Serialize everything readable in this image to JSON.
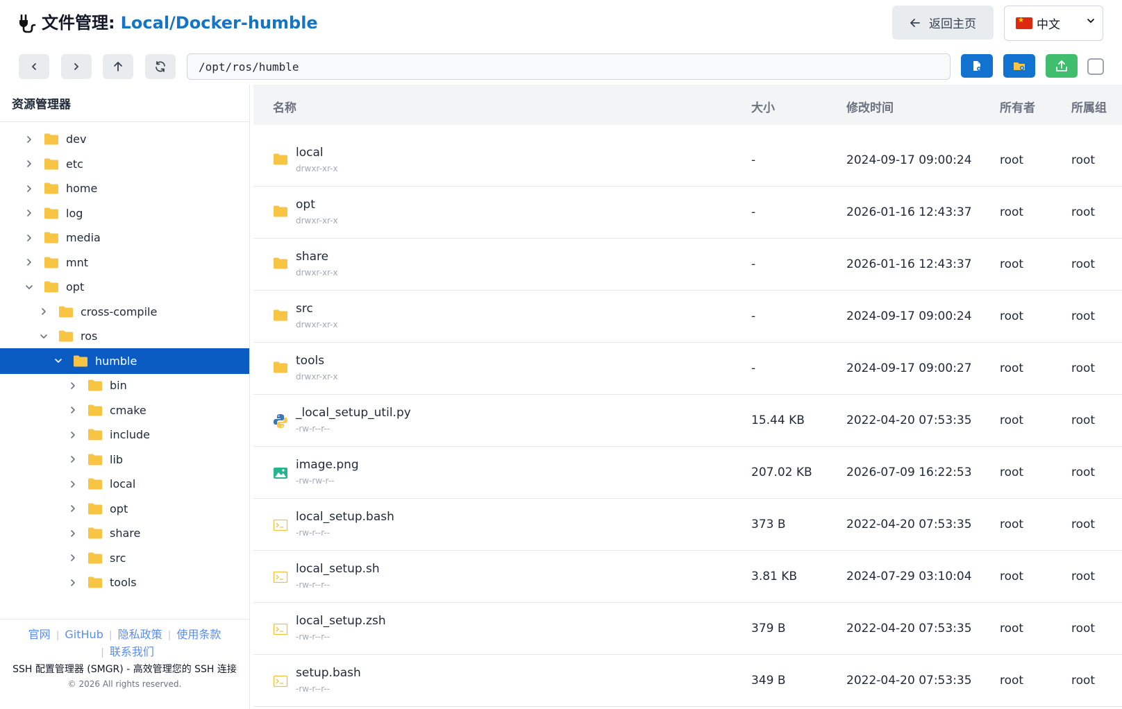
{
  "header": {
    "title_label": "文件管理:",
    "title_path": "Local/Docker-humble",
    "home_button": "返回主页",
    "language": "中文"
  },
  "toolbar": {
    "path": "/opt/ros/humble"
  },
  "sidebar": {
    "title": "资源管理器",
    "items": [
      {
        "label": "dev",
        "depth": 0,
        "expanded": false
      },
      {
        "label": "etc",
        "depth": 0,
        "expanded": false
      },
      {
        "label": "home",
        "depth": 0,
        "expanded": false
      },
      {
        "label": "log",
        "depth": 0,
        "expanded": false
      },
      {
        "label": "media",
        "depth": 0,
        "expanded": false
      },
      {
        "label": "mnt",
        "depth": 0,
        "expanded": false
      },
      {
        "label": "opt",
        "depth": 0,
        "expanded": true
      },
      {
        "label": "cross-compile",
        "depth": 1,
        "expanded": false
      },
      {
        "label": "ros",
        "depth": 1,
        "expanded": true
      },
      {
        "label": "humble",
        "depth": 2,
        "expanded": true,
        "selected": true
      },
      {
        "label": "bin",
        "depth": 3,
        "expanded": false
      },
      {
        "label": "cmake",
        "depth": 3,
        "expanded": false
      },
      {
        "label": "include",
        "depth": 3,
        "expanded": false
      },
      {
        "label": "lib",
        "depth": 3,
        "expanded": false
      },
      {
        "label": "local",
        "depth": 3,
        "expanded": false
      },
      {
        "label": "opt",
        "depth": 3,
        "expanded": false
      },
      {
        "label": "share",
        "depth": 3,
        "expanded": false
      },
      {
        "label": "src",
        "depth": 3,
        "expanded": false
      },
      {
        "label": "tools",
        "depth": 3,
        "expanded": false
      }
    ]
  },
  "footer": {
    "links": [
      "官网",
      "GitHub",
      "隐私政策",
      "使用条款",
      "联系我们"
    ],
    "description": "SSH 配置管理器 (SMGR) - 高效管理您的 SSH 连接",
    "copyright": "© 2026 All rights reserved."
  },
  "table": {
    "headers": {
      "name": "名称",
      "size": "大小",
      "mtime": "修改时间",
      "owner": "所有者",
      "group": "所属组"
    },
    "rows": [
      {
        "name": "local",
        "perm": "drwxr-xr-x",
        "size": "-",
        "mtime": "2024-09-17 09:00:24",
        "owner": "root",
        "group": "root",
        "type": "folder"
      },
      {
        "name": "opt",
        "perm": "drwxr-xr-x",
        "size": "-",
        "mtime": "2026-01-16 12:43:37",
        "owner": "root",
        "group": "root",
        "type": "folder"
      },
      {
        "name": "share",
        "perm": "drwxr-xr-x",
        "size": "-",
        "mtime": "2026-01-16 12:43:37",
        "owner": "root",
        "group": "root",
        "type": "folder"
      },
      {
        "name": "src",
        "perm": "drwxr-xr-x",
        "size": "-",
        "mtime": "2024-09-17 09:00:24",
        "owner": "root",
        "group": "root",
        "type": "folder"
      },
      {
        "name": "tools",
        "perm": "drwxr-xr-x",
        "size": "-",
        "mtime": "2024-09-17 09:00:27",
        "owner": "root",
        "group": "root",
        "type": "folder"
      },
      {
        "name": "_local_setup_util.py",
        "perm": "-rw-r--r--",
        "size": "15.44 KB",
        "mtime": "2022-04-20 07:53:35",
        "owner": "root",
        "group": "root",
        "type": "python"
      },
      {
        "name": "image.png",
        "perm": "-rw-rw-r--",
        "size": "207.02 KB",
        "mtime": "2026-07-09 16:22:53",
        "owner": "root",
        "group": "root",
        "type": "image"
      },
      {
        "name": "local_setup.bash",
        "perm": "-rw-r--r--",
        "size": "373 B",
        "mtime": "2022-04-20 07:53:35",
        "owner": "root",
        "group": "root",
        "type": "shell"
      },
      {
        "name": "local_setup.sh",
        "perm": "-rw-r--r--",
        "size": "3.81 KB",
        "mtime": "2024-07-29 03:10:04",
        "owner": "root",
        "group": "root",
        "type": "shell"
      },
      {
        "name": "local_setup.zsh",
        "perm": "-rw-r--r--",
        "size": "379 B",
        "mtime": "2022-04-20 07:53:35",
        "owner": "root",
        "group": "root",
        "type": "shell"
      },
      {
        "name": "setup.bash",
        "perm": "-rw-r--r--",
        "size": "349 B",
        "mtime": "2022-04-20 07:53:35",
        "owner": "root",
        "group": "root",
        "type": "shell"
      }
    ]
  },
  "colors": {
    "accent": "#1674c4",
    "selected": "#0a5cc2",
    "folder": "#f8c443",
    "upload": "#3fbf6d"
  }
}
